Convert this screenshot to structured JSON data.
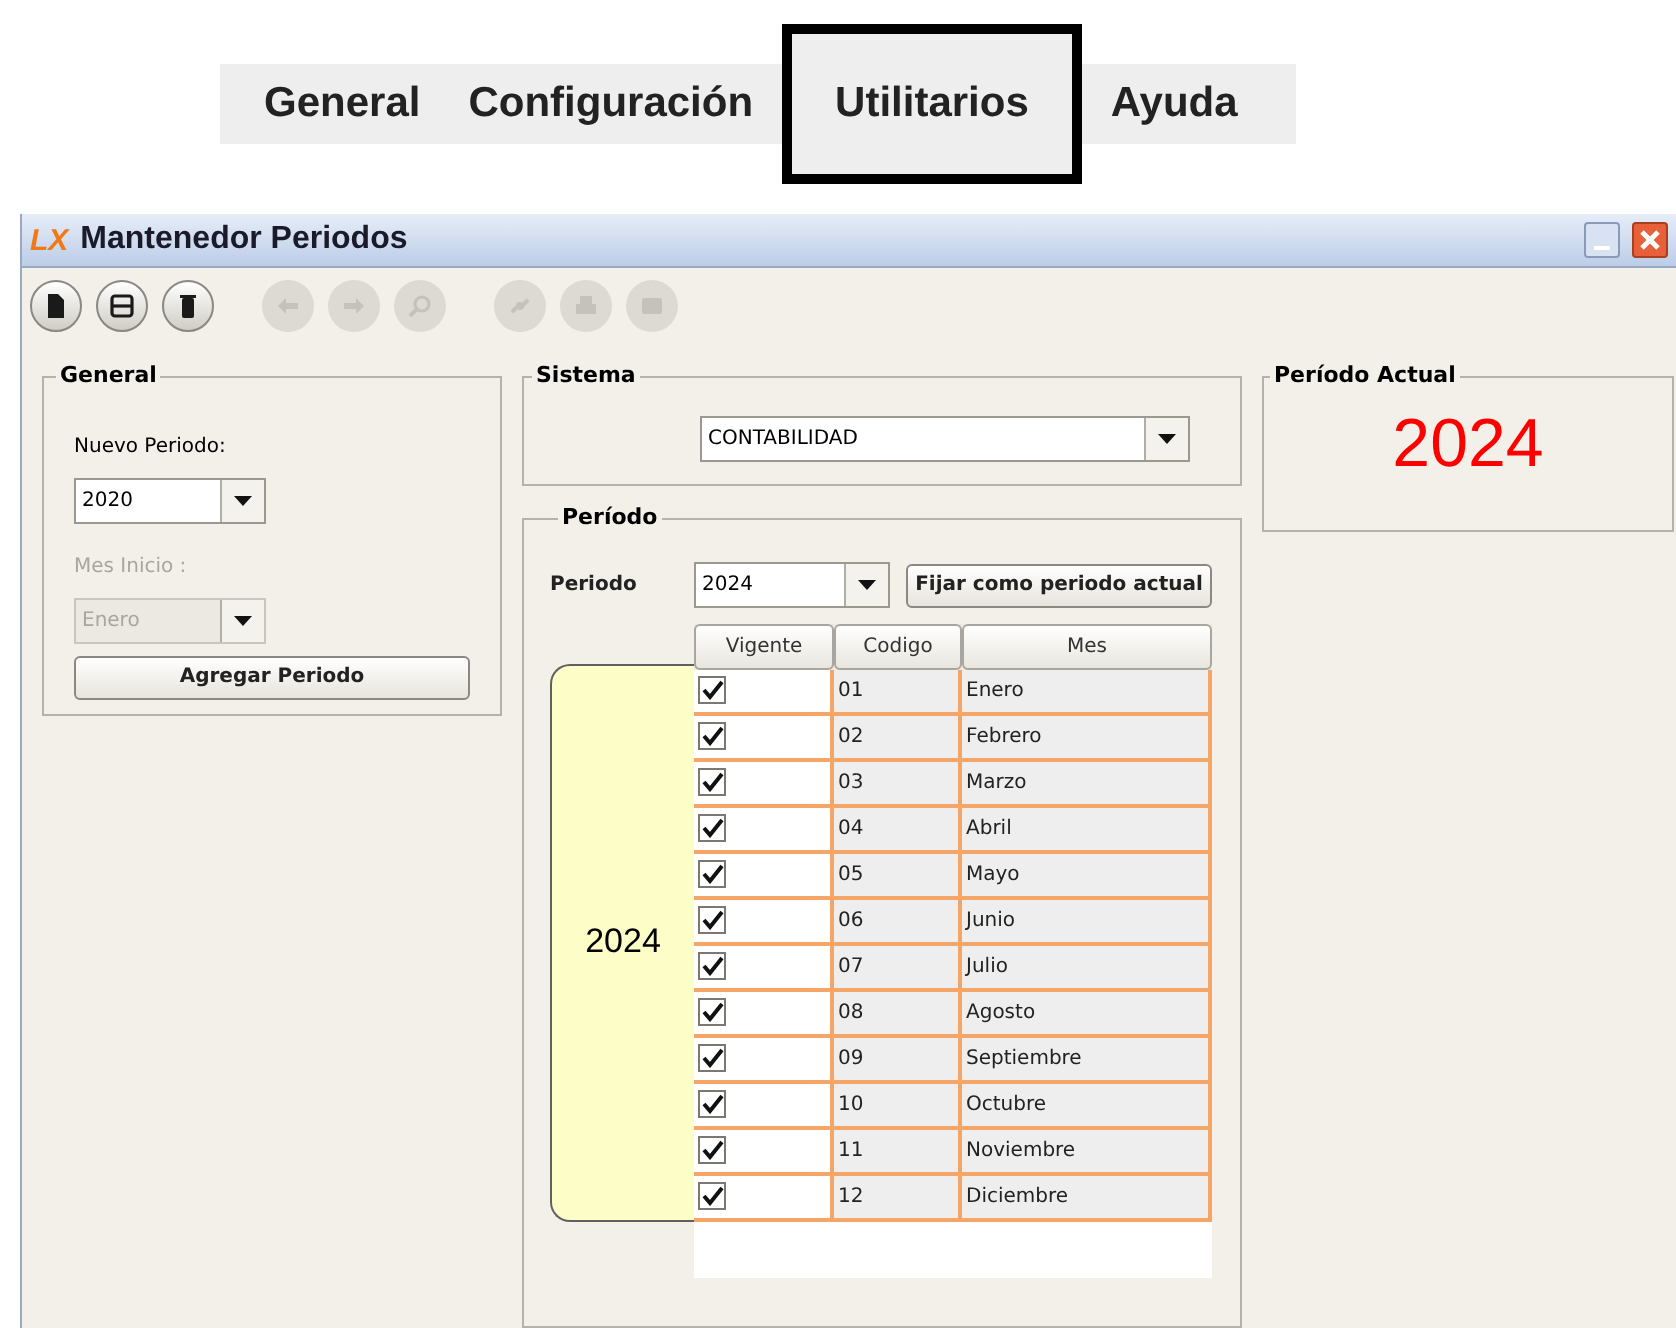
{
  "menu": [
    {
      "label": "General",
      "selected": false
    },
    {
      "label": "Configuración",
      "selected": false
    },
    {
      "label": "Utilitarios",
      "selected": true
    },
    {
      "label": "Ayuda",
      "selected": false
    }
  ],
  "window": {
    "logo": "LX",
    "title": "Mantenedor Periodos"
  },
  "toolbar": [
    [
      {
        "kind": "document",
        "disabled": false
      },
      {
        "kind": "save",
        "disabled": false
      },
      {
        "kind": "trash",
        "disabled": false
      }
    ],
    [
      {
        "kind": "back",
        "disabled": true
      },
      {
        "kind": "forward",
        "disabled": true
      },
      {
        "kind": "search",
        "disabled": true
      }
    ],
    [
      {
        "kind": "link",
        "disabled": true
      },
      {
        "kind": "print",
        "disabled": true
      },
      {
        "kind": "stop",
        "disabled": true
      }
    ]
  ],
  "general": {
    "title": "General",
    "nuevo_periodo": {
      "label": "Nuevo Periodo:",
      "value": "2020",
      "disabled": false
    },
    "mes_inicio": {
      "label": "Mes Inicio :",
      "value": "Enero",
      "disabled": true
    },
    "button": "Agregar Periodo"
  },
  "sistema": {
    "title": "Sistema",
    "value": "CONTABILIDAD"
  },
  "periodo": {
    "title": "Período",
    "label": "Periodo",
    "value": "2024",
    "button": "Fijar como periodo actual",
    "tab_label": "2024",
    "table": {
      "columns": [
        "Vigente",
        "Codigo",
        "Mes"
      ],
      "rows": [
        {
          "vigente": true,
          "codigo": "01",
          "mes": "Enero"
        },
        {
          "vigente": true,
          "codigo": "02",
          "mes": "Febrero"
        },
        {
          "vigente": true,
          "codigo": "03",
          "mes": "Marzo"
        },
        {
          "vigente": true,
          "codigo": "04",
          "mes": "Abril"
        },
        {
          "vigente": true,
          "codigo": "05",
          "mes": "Mayo"
        },
        {
          "vigente": true,
          "codigo": "06",
          "mes": "Junio"
        },
        {
          "vigente": true,
          "codigo": "07",
          "mes": "Julio"
        },
        {
          "vigente": true,
          "codigo": "08",
          "mes": "Agosto"
        },
        {
          "vigente": true,
          "codigo": "09",
          "mes": "Septiembre"
        },
        {
          "vigente": true,
          "codigo": "10",
          "mes": "Octubre"
        },
        {
          "vigente": true,
          "codigo": "11",
          "mes": "Noviembre"
        },
        {
          "vigente": true,
          "codigo": "12",
          "mes": "Diciembre"
        }
      ]
    }
  },
  "periodo_actual": {
    "title": "Período Actual",
    "value": "2024"
  }
}
